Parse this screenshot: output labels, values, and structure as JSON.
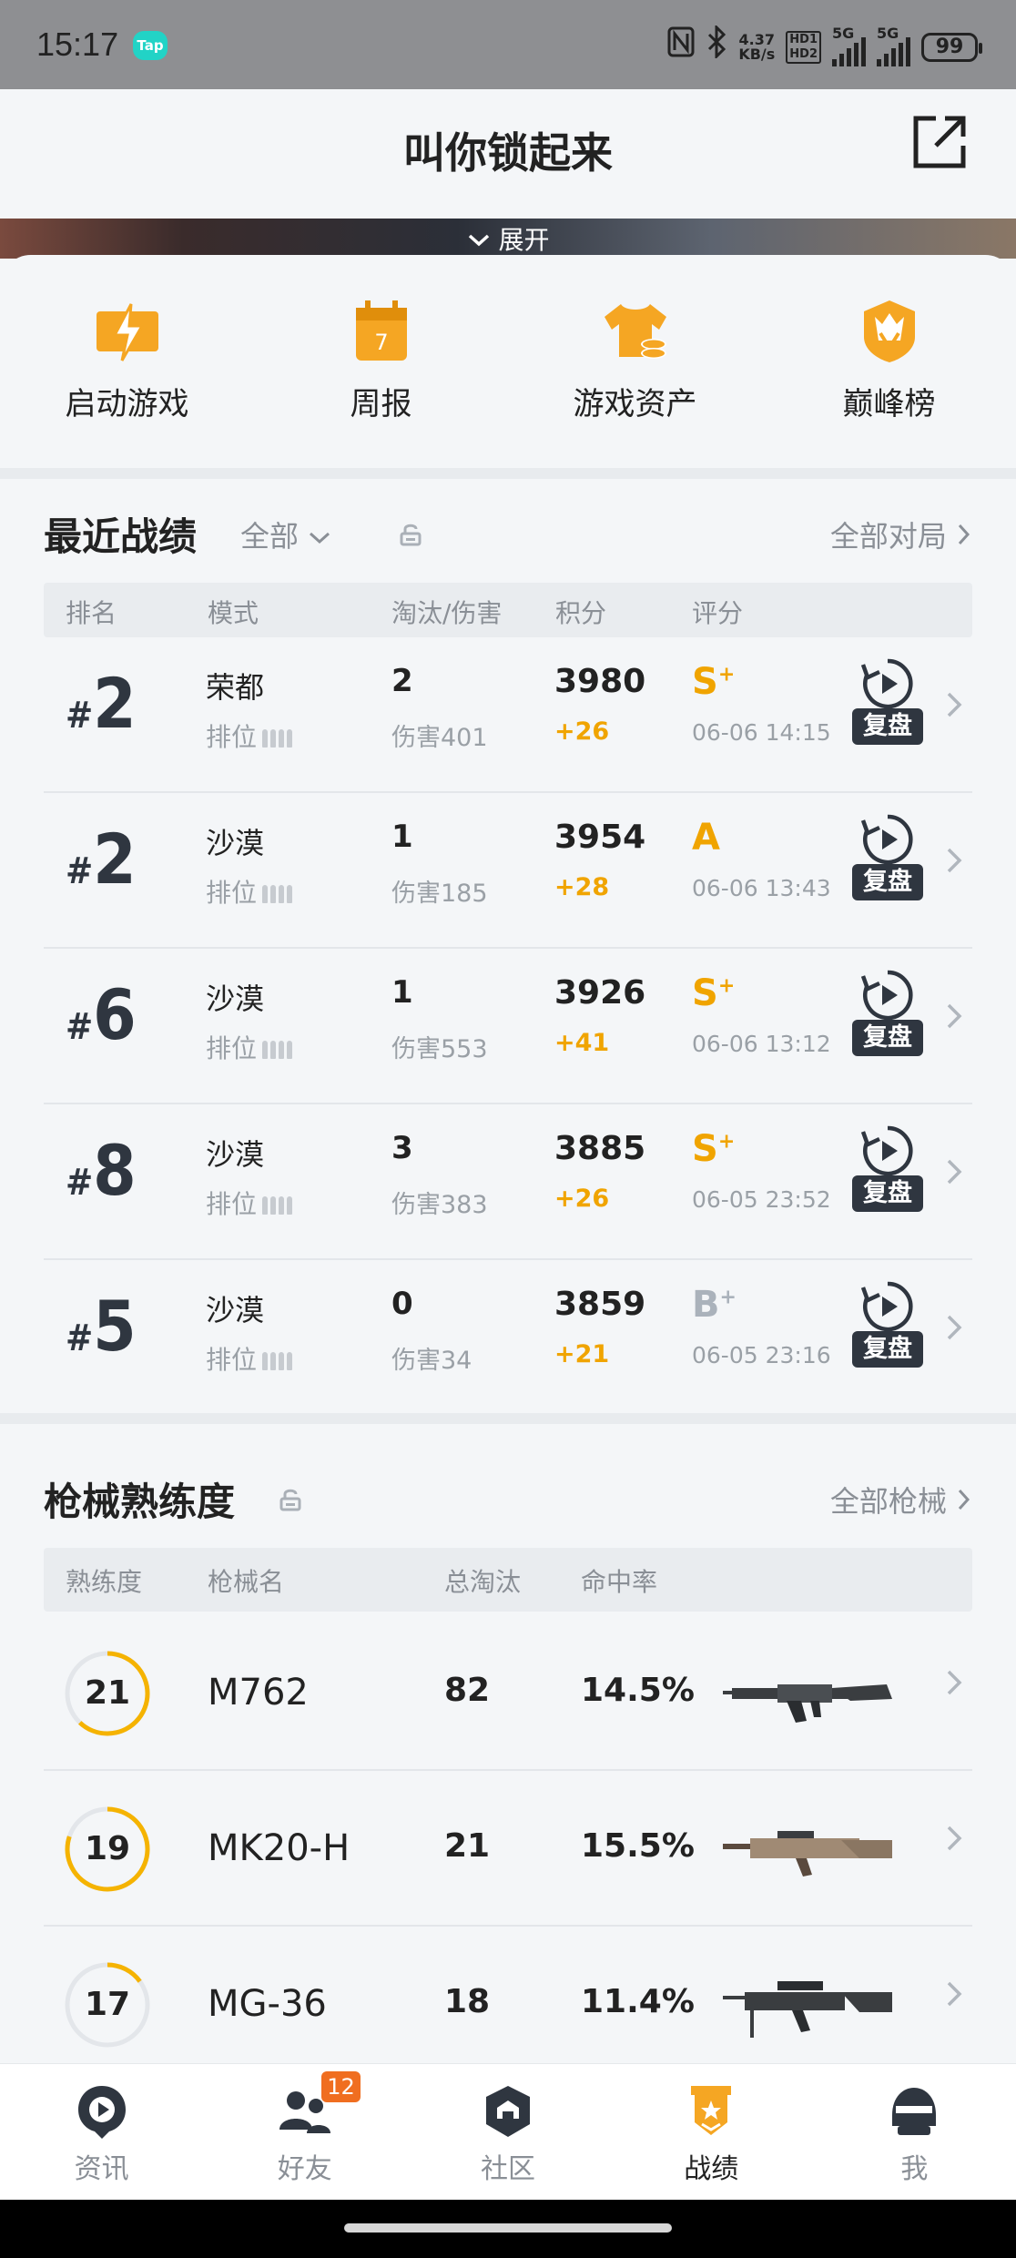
{
  "status_bar": {
    "time": "15:17",
    "tap_label": "Tap",
    "net_speed_value": "4.37",
    "net_speed_unit": "KB/s",
    "hd1": "HD1",
    "hd2": "HD2",
    "signal1": "5G",
    "signal2": "5G",
    "battery": "99"
  },
  "header": {
    "title": "叫你锁起来",
    "expand_label": "展开"
  },
  "quick_actions": [
    {
      "label": "启动游戏",
      "icon": "lightning-icon"
    },
    {
      "label": "周报",
      "icon": "calendar-icon",
      "day": "7"
    },
    {
      "label": "游戏资产",
      "icon": "shirt-coin-icon"
    },
    {
      "label": "巅峰榜",
      "icon": "crown-badge-icon"
    }
  ],
  "recent": {
    "title": "最近战绩",
    "filter": "全部",
    "link": "全部对局",
    "columns": [
      "排名",
      "模式",
      "淘汰/伤害",
      "积分",
      "评分"
    ],
    "replay_label": "复盘",
    "rows": [
      {
        "hash": "#",
        "rank": "2",
        "mode": "荣都",
        "type": "排位",
        "kills": "2",
        "damage": "伤害401",
        "score": "3980",
        "delta": "+26",
        "grade": "S",
        "grade_plus": "+",
        "grade_color": "#f0a400",
        "date": "06-06 14:15"
      },
      {
        "hash": "#",
        "rank": "2",
        "mode": "沙漠",
        "type": "排位",
        "kills": "1",
        "damage": "伤害185",
        "score": "3954",
        "delta": "+28",
        "grade": "A",
        "grade_plus": "",
        "grade_color": "#f0a400",
        "date": "06-06 13:43"
      },
      {
        "hash": "#",
        "rank": "6",
        "mode": "沙漠",
        "type": "排位",
        "kills": "1",
        "damage": "伤害553",
        "score": "3926",
        "delta": "+41",
        "grade": "S",
        "grade_plus": "+",
        "grade_color": "#f0a400",
        "date": "06-06 13:12"
      },
      {
        "hash": "#",
        "rank": "8",
        "mode": "沙漠",
        "type": "排位",
        "kills": "3",
        "damage": "伤害383",
        "score": "3885",
        "delta": "+26",
        "grade": "S",
        "grade_plus": "+",
        "grade_color": "#f0a400",
        "date": "06-05 23:52"
      },
      {
        "hash": "#",
        "rank": "5",
        "mode": "沙漠",
        "type": "排位",
        "kills": "0",
        "damage": "伤害34",
        "score": "3859",
        "delta": "+21",
        "grade": "B",
        "grade_plus": "+",
        "grade_color": "#aab2bb",
        "date": "06-05 23:16"
      }
    ]
  },
  "weapons": {
    "title": "枪械熟练度",
    "link": "全部枪械",
    "columns": [
      "熟练度",
      "枪械名",
      "总淘汰",
      "命中率"
    ],
    "rows": [
      {
        "level": "21",
        "progress": 0.62,
        "name": "M762",
        "kills": "82",
        "accuracy": "14.5%"
      },
      {
        "level": "19",
        "progress": 0.8,
        "name": "MK20-H",
        "kills": "21",
        "accuracy": "15.5%"
      },
      {
        "level": "17",
        "progress": 0.15,
        "name": "MG-36",
        "kills": "18",
        "accuracy": "11.4%"
      }
    ]
  },
  "nav": {
    "items": [
      {
        "label": "资讯",
        "icon": "news-play-icon"
      },
      {
        "label": "好友",
        "icon": "friends-icon",
        "badge": "12"
      },
      {
        "label": "社区",
        "icon": "community-icon"
      },
      {
        "label": "战绩",
        "icon": "stats-badge-icon"
      },
      {
        "label": "我",
        "icon": "helmet-icon"
      }
    ]
  },
  "colors": {
    "accent": "#f0a400",
    "badge": "#f06e20",
    "dark": "#2f3640"
  }
}
